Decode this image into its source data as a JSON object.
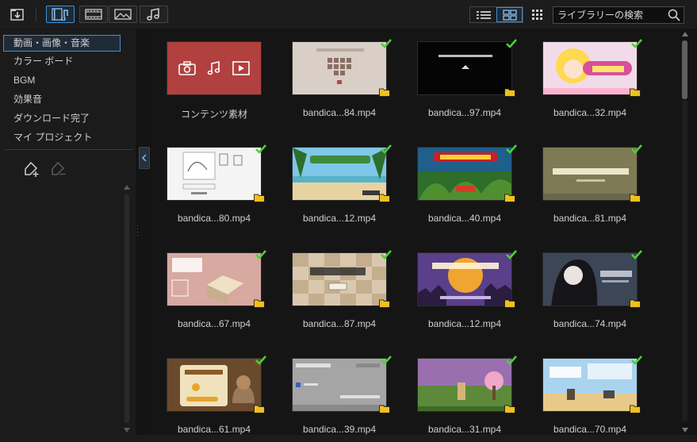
{
  "toolbar": {
    "search_placeholder": "ライブラリーの検索"
  },
  "sidebar": {
    "categories": [
      {
        "label": "動画・画像・音楽",
        "active": true
      },
      {
        "label": "カラー ボード",
        "active": false
      },
      {
        "label": "BGM",
        "active": false
      },
      {
        "label": "効果音",
        "active": false
      },
      {
        "label": "ダウンロード完了",
        "active": false
      },
      {
        "label": "マイ プロジェクト",
        "active": false
      }
    ]
  },
  "media": {
    "items": [
      {
        "caption": "コンテンツ素材",
        "thumb": "content-folder",
        "checked": false
      },
      {
        "caption": "bandica...84.mp4",
        "thumb": "beige-grid",
        "checked": true
      },
      {
        "caption": "bandica...97.mp4",
        "thumb": "black-text",
        "checked": true
      },
      {
        "caption": "bandica...32.mp4",
        "thumb": "anime-pink",
        "checked": true
      },
      {
        "caption": "bandica...80.mp4",
        "thumb": "white-sketch",
        "checked": true
      },
      {
        "caption": "bandica...12.mp4",
        "thumb": "beach",
        "checked": true
      },
      {
        "caption": "bandica...40.mp4",
        "thumb": "jungle",
        "checked": true
      },
      {
        "caption": "bandica...81.mp4",
        "thumb": "olive-title",
        "checked": true
      },
      {
        "caption": "bandica...67.mp4",
        "thumb": "pink-iso",
        "checked": true
      },
      {
        "caption": "bandica...87.mp4",
        "thumb": "dice",
        "checked": true
      },
      {
        "caption": "bandica...12.mp4",
        "thumb": "halloween",
        "checked": true
      },
      {
        "caption": "bandica...74.mp4",
        "thumb": "dark-anime",
        "checked": true
      },
      {
        "caption": "bandica...61.mp4",
        "thumb": "cat-game",
        "checked": true
      },
      {
        "caption": "bandica...39.mp4",
        "thumb": "gray-ui",
        "checked": true
      },
      {
        "caption": "bandica...31.mp4",
        "thumb": "pink-field",
        "checked": true
      },
      {
        "caption": "bandica...70.mp4",
        "thumb": "sky-game",
        "checked": true
      }
    ]
  },
  "colors": {
    "accent": "#3f8fd6",
    "check": "#4cd137",
    "folder": "#f0c020",
    "content_tile": "#b2403e"
  }
}
